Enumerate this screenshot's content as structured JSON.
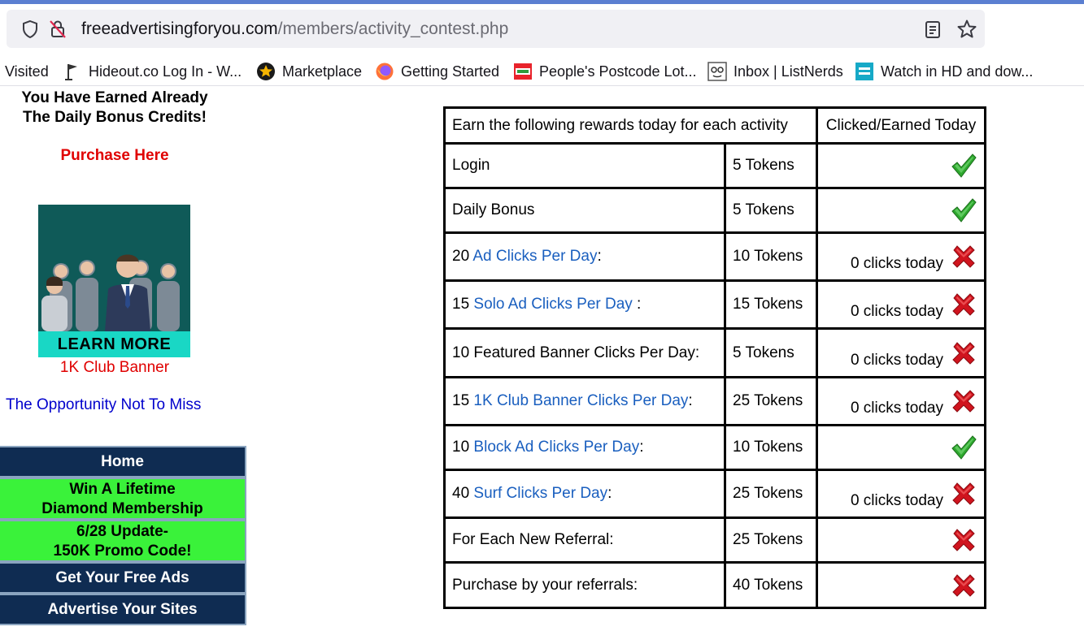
{
  "browser": {
    "url_host": "freeadvertisingforyou.com",
    "url_path": "/members/activity_contest.php",
    "bookmarks": [
      {
        "label": "Visited",
        "icon": "none"
      },
      {
        "label": "Hideout.co Log In - W...",
        "icon": "flag-icon"
      },
      {
        "label": "Marketplace",
        "icon": "star-badge-icon"
      },
      {
        "label": "Getting Started",
        "icon": "firefox-icon"
      },
      {
        "label": "People's Postcode Lot...",
        "icon": "postcode-lottery-icon"
      },
      {
        "label": "Inbox | ListNerds",
        "icon": "listnerds-icon"
      },
      {
        "label": "Watch in HD and dow...",
        "icon": "erosnow-icon"
      }
    ]
  },
  "sidebar": {
    "earned_line1": "You Have Earned Already",
    "earned_line2": "The Daily Bonus Credits!",
    "purchase_label": "Purchase Here",
    "banner_button": "LEARN MORE",
    "banner_caption": "1K Club Banner",
    "opportunity_text": "The Opportunity Not To Miss",
    "menu": [
      {
        "line1": "Home",
        "line2": "",
        "style": "blue"
      },
      {
        "line1": "Win A Lifetime",
        "line2": "Diamond Membership",
        "style": "green"
      },
      {
        "line1": "6/28 Update-",
        "line2": "150K Promo Code!",
        "style": "green"
      },
      {
        "line1": "Get Your Free Ads",
        "line2": "",
        "style": "blue"
      },
      {
        "line1": "Advertise Your Sites",
        "line2": "",
        "style": "blue"
      }
    ]
  },
  "table": {
    "header_activity": "Earn the following rewards today for each activity",
    "header_status": "Clicked/Earned Today",
    "rows": [
      {
        "prefix": "Login",
        "link": "",
        "suffix": "",
        "reward": "5 Tokens",
        "clicks": "",
        "status": "done"
      },
      {
        "prefix": "Daily Bonus",
        "link": "",
        "suffix": "",
        "reward": "5 Tokens",
        "clicks": "",
        "status": "done"
      },
      {
        "prefix": "20 ",
        "link": "Ad Clicks Per Day",
        "suffix": ":",
        "reward": "10 Tokens",
        "clicks": "0 clicks today",
        "status": "not-done"
      },
      {
        "prefix": "15 ",
        "link": "Solo Ad Clicks Per Day",
        "suffix": " :",
        "reward": "15 Tokens",
        "clicks": "0 clicks today",
        "status": "not-done"
      },
      {
        "prefix": "10 Featured Banner Clicks Per Day:",
        "link": "",
        "suffix": "",
        "reward": "5 Tokens",
        "clicks": "0 clicks today",
        "status": "not-done"
      },
      {
        "prefix": "15 ",
        "link": "1K Club Banner Clicks Per Day",
        "suffix": ":",
        "reward": "25 Tokens",
        "clicks": "0 clicks today",
        "status": "not-done"
      },
      {
        "prefix": "10 ",
        "link": "Block Ad Clicks Per Day",
        "suffix": ":",
        "reward": "10 Tokens",
        "clicks": "",
        "status": "done"
      },
      {
        "prefix": "40 ",
        "link": "Surf Clicks Per Day",
        "suffix": ":",
        "reward": "25 Tokens",
        "clicks": "0 clicks today",
        "status": "not-done"
      },
      {
        "prefix": "For Each New Referral:",
        "link": "",
        "suffix": "",
        "reward": "25 Tokens",
        "clicks": "",
        "status": "not-done"
      },
      {
        "prefix": "Purchase by your referrals:",
        "link": "",
        "suffix": "",
        "reward": "40 Tokens",
        "clicks": "",
        "status": "not-done"
      }
    ]
  },
  "colors": {
    "link": "#1a5fbf",
    "purchase_red": "#e00000",
    "menu_blue": "#0f2c52",
    "menu_green": "#3af23a",
    "check_green": "#2ea82e",
    "cross_red": "#d0141e"
  }
}
